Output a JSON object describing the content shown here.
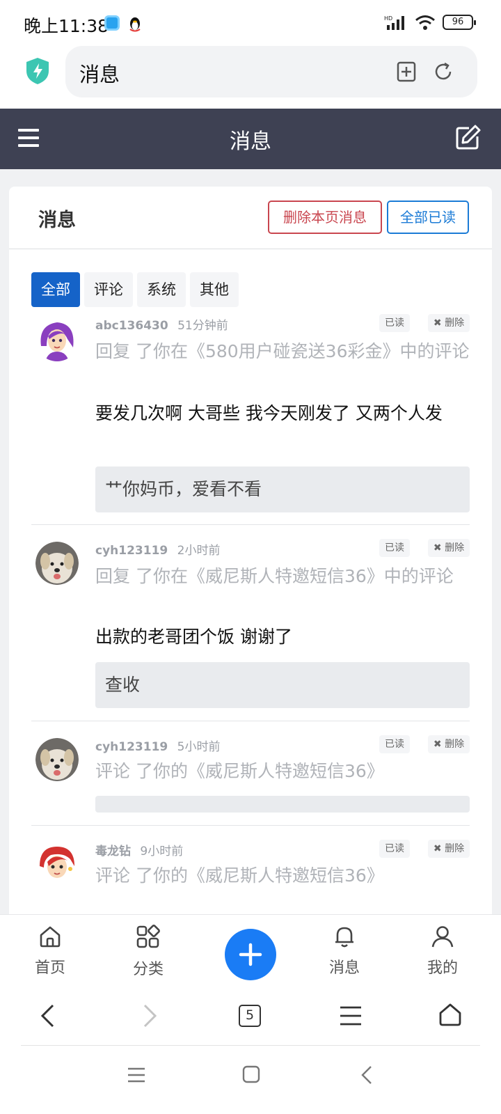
{
  "status_bar": {
    "time": "晚上11:38",
    "battery": "96"
  },
  "url_bar": {
    "text": "消息",
    "icons": [
      "shield-icon",
      "add-bookmark-icon",
      "reload-icon"
    ]
  },
  "nav": {
    "title": "消息",
    "menu_icon": "hamburger-icon",
    "edit_icon": "edit-icon"
  },
  "card": {
    "title": "消息",
    "delete_page_label": "删除本页消息",
    "mark_all_read_label": "全部已读"
  },
  "tabs": [
    {
      "label": "全部",
      "active": true
    },
    {
      "label": "评论",
      "active": false
    },
    {
      "label": "系统",
      "active": false
    },
    {
      "label": "其他",
      "active": false
    }
  ],
  "messages": [
    {
      "username": "abc136430",
      "time": "51分钟前",
      "read_label": "已读",
      "delete_label": "删除",
      "action": "回复 了你在《580用户碰瓷送36彩金》中的评论",
      "content": "要发几次啊 大哥些 我今天刚发了 又两个人发",
      "quote": "艹你妈币，爱看不看"
    },
    {
      "username": "cyh123119",
      "time": "2小时前",
      "read_label": "已读",
      "delete_label": "删除",
      "action": "回复 了你在《威尼斯人特邀短信36》中的评论",
      "content": "出款的老哥团个饭 谢谢了",
      "quote": "查收"
    },
    {
      "username": "cyh123119",
      "time": "5小时前",
      "read_label": "已读",
      "delete_label": "删除",
      "action": "评论 了你的《威尼斯人特邀短信36》",
      "content": "",
      "quote": ""
    },
    {
      "username": "毒龙钻",
      "time": "9小时前",
      "read_label": "已读",
      "delete_label": "删除",
      "action": "评论 了你的《威尼斯人特邀短信36》",
      "content": "",
      "quote": ""
    }
  ],
  "bottom_nav": {
    "home": "首页",
    "category": "分类",
    "messages": "消息",
    "mine": "我的"
  },
  "browser_bar": {
    "tab_count": "5"
  }
}
